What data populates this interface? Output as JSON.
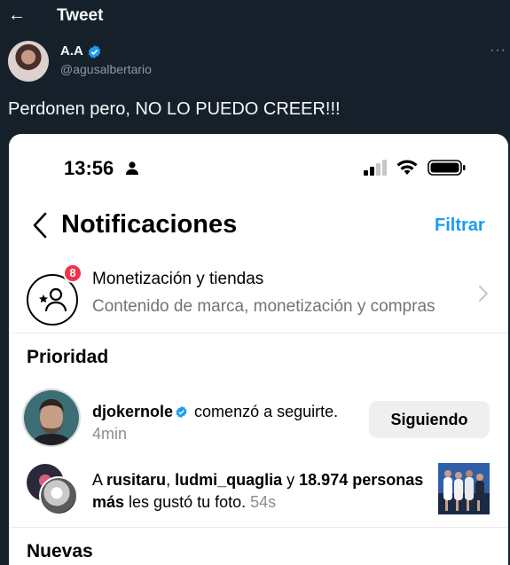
{
  "header": {
    "title": "Tweet"
  },
  "author": {
    "name": "A.A",
    "handle": "@agusalbertario"
  },
  "tweet": {
    "text": "Perdonen pero, NO LO PUEDO CREER!!!"
  },
  "screenshot": {
    "status_bar": {
      "time": "13:56"
    },
    "title": "Notificaciones",
    "filter_label": "Filtrar",
    "monetization": {
      "badge_count": "8",
      "title": "Monetización y tiendas",
      "subtitle": "Contenido de marca, monetización y compras"
    },
    "sections": {
      "priority": "Prioridad",
      "new": "Nuevas"
    },
    "follow_notification": {
      "username": "djokernole",
      "action": "comenzó a seguirte.",
      "time": "4min",
      "button_label": "Siguiendo"
    },
    "likes_notification": {
      "prefix": "A",
      "user1": "rusitaru",
      "separator": ",",
      "user2": "ludmi_quaglia",
      "conjunction": "y",
      "others": "18.974 personas más",
      "action": "les gustó tu foto.",
      "time": "54s"
    }
  },
  "colors": {
    "twitter_bg": "#15202b",
    "verified_blue": "#1d9bf0",
    "instagram_link": "#1a9bf0",
    "badge_red": "#f23048"
  }
}
